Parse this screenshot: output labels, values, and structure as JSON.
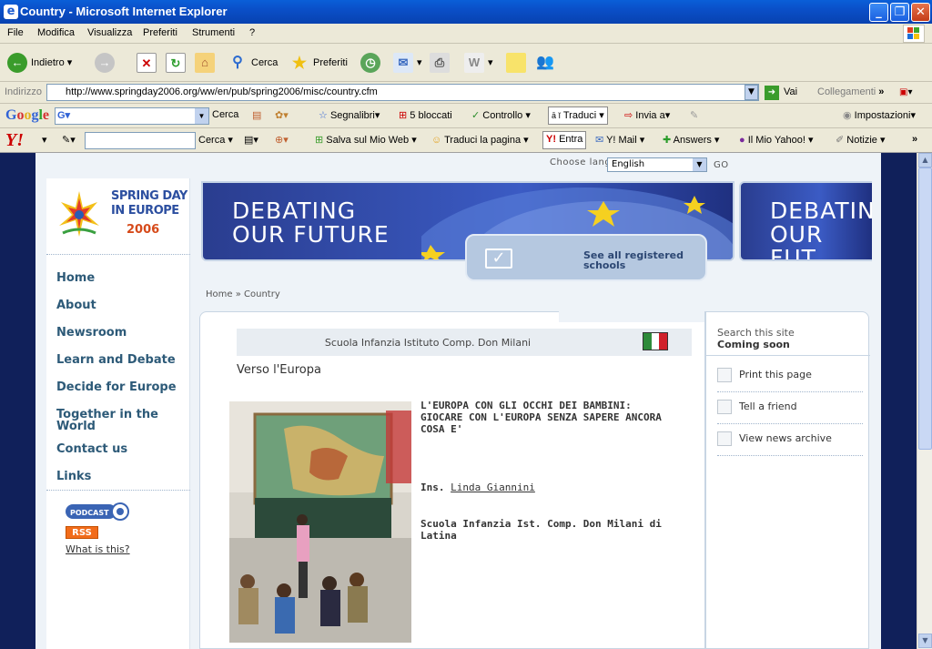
{
  "window": {
    "title": "Country - Microsoft Internet Explorer"
  },
  "menu": [
    "File",
    "Modifica",
    "Visualizza",
    "Preferiti",
    "Strumenti",
    "?"
  ],
  "toolbar": {
    "back": "Indietro",
    "search": "Cerca",
    "favorites": "Preferiti"
  },
  "address": {
    "label": "Indirizzo",
    "url": "http://www.springday2006.org/ww/en/pub/spring2006/misc/country.cfm",
    "go": "Vai",
    "links": "Collegamenti"
  },
  "google": {
    "logo": "Google",
    "search": "Cerca",
    "bookmarks": "Segnalibri",
    "blocked": "5 bloccati",
    "check": "Controllo",
    "translate": "Traduci",
    "send": "Invia a",
    "settings": "Impostazioni"
  },
  "yahoo": {
    "logo": "Y!",
    "search": "Cerca",
    "save": "Salva sul Mio Web",
    "translate_page": "Traduci la pagina",
    "login": "Entra",
    "mail": "Y! Mail",
    "answers": "Answers",
    "my_yahoo": "Il Mio Yahoo!",
    "news": "Notizie"
  },
  "site": {
    "choose_language": "Choose language",
    "language": "English",
    "go": "GO",
    "logo": {
      "line1": "SPRING DAY",
      "line2": "IN EUROPE",
      "year": "2006"
    },
    "nav": [
      "Home",
      "About",
      "Newsroom",
      "Learn and Debate",
      "Decide for Europe",
      "Together in the World",
      "Contact us",
      "Links"
    ],
    "podcast": "PODCAST",
    "rss": "RSS",
    "what_is_this": "What is this?",
    "banner": {
      "line1": "DEBATING",
      "line2": "OUR FUTURE",
      "line1b": "DEBATIN",
      "line2b": "OUR FUT"
    },
    "see_all": {
      "line1": "See all registered",
      "line2": "schools"
    },
    "breadcrumb": {
      "home": "Home",
      "sep": "»",
      "current": "Country"
    },
    "school_name": "Scuola Infanzia Istituto Comp. Don Milani",
    "section_title": "Verso l'Europa",
    "article_title": "L'EUROPA CON GLI OCCHI DEI BAMBINI: GIOCARE CON L'EUROPA SENZA SAPERE ANCORA COSA E'",
    "teacher_prefix": "Ins.",
    "teacher": "Linda Giannini",
    "school_full": "Scuola Infanzia Ist. Comp. Don Milani di Latina",
    "search_site": "Search this site",
    "coming_soon": "Coming soon",
    "right_links": [
      "Print this page",
      "Tell a friend",
      "View news archive"
    ]
  },
  "colors": {
    "accent": "#2d5a78",
    "flag": [
      "#2e8b3a",
      "#ffffff",
      "#d0212a"
    ]
  }
}
